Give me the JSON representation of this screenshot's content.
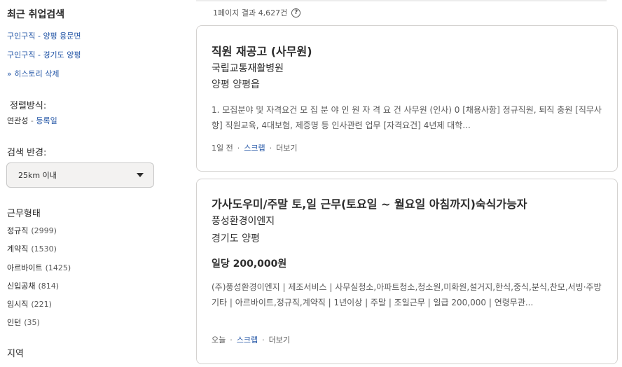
{
  "sidebar": {
    "recent_heading": "최근 취업검색",
    "recent_searches": [
      "구인구직 - 양평 용문면",
      "구인구직 - 경기도 양평"
    ],
    "history_delete": "» 히스토리 삭제",
    "sort_label": "정렬방식:",
    "sort_current": "연관성",
    "sort_separator": "-",
    "sort_alt": "등록일",
    "radius_label": "검색 반경:",
    "radius_value": "25km 이내",
    "job_type_heading": "근무형태",
    "job_types": [
      {
        "label": "정규직",
        "count": "(2999)"
      },
      {
        "label": "계약직",
        "count": "(1530)"
      },
      {
        "label": "아르바이트",
        "count": "(1425)"
      },
      {
        "label": "신입공채",
        "count": "(814)"
      },
      {
        "label": "임시직",
        "count": "(221)"
      },
      {
        "label": "인턴",
        "count": "(35)"
      }
    ],
    "region_heading": "지역"
  },
  "results": {
    "count_text": "1페이지 결과 4,627건",
    "help_glyph": "?",
    "cards": [
      {
        "title": "직원 재공고 (사무원)",
        "company": "국립교통재활병원",
        "location": "양평 양평읍",
        "salary": "",
        "snippet": "1. 모집분야 및 자격요건 모 집 분 야 인 원 자 격 요 건 사무원 (인사) 0 [채용사항] 정규직원, 퇴직 충원 [직무사항] 직원교육, 4대보험, 제증명 등 인사관련 업무 [자격요건] 4년제 대학...",
        "posted": "1일 전",
        "scrap": "스크랩",
        "more": "더보기"
      },
      {
        "title": "가사도우미/주말 토,일 근무(토요일 ~ 월요일 아침까지)숙식가능자",
        "company": "풍성환경이엔지",
        "location": "경기도 양평",
        "salary": "일당 200,000원",
        "snippet": "(주)풍성환경이엔지 | 제조서비스 | 사무실청소,아파트청소,청소원,미화원,설거지,한식,중식,분식,찬모,서빙·주방 기타 | 아르바이트,정규직,계약직 | 1년이상 | 주말 | 조일근무 | 일급 200,000 | 연령무관...",
        "posted": "오늘",
        "scrap": "스크랩",
        "more": "더보기"
      }
    ]
  }
}
